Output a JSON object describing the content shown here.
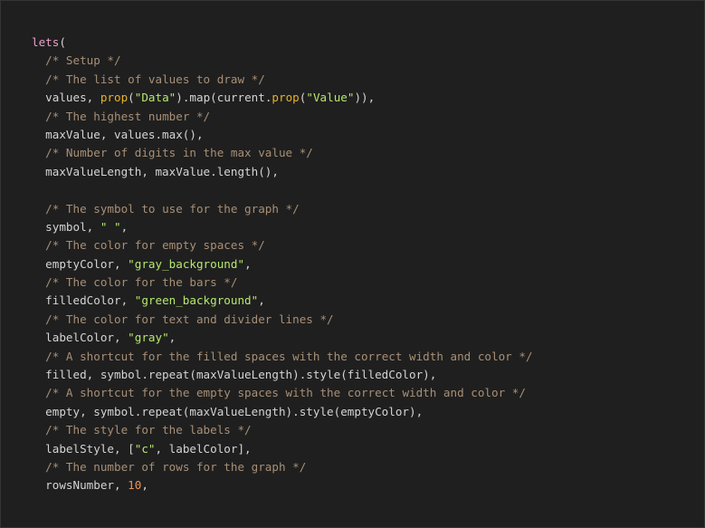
{
  "colors": {
    "background": "#1f1f1f",
    "text": "#d4d4d4",
    "comment": "#a88f76",
    "string": "#b5e86b",
    "function": "#e6b32a",
    "keyword": "#e8a0c8",
    "number": "#e8935b"
  },
  "code": {
    "lines": [
      [
        {
          "t": "lets",
          "k": "keyword"
        },
        {
          "t": "(",
          "k": "text"
        }
      ],
      [
        {
          "t": "  ",
          "k": "text"
        },
        {
          "t": "/* Setup */",
          "k": "comment"
        }
      ],
      [
        {
          "t": "  ",
          "k": "text"
        },
        {
          "t": "/* The list of values to draw */",
          "k": "comment"
        }
      ],
      [
        {
          "t": "  values, ",
          "k": "text"
        },
        {
          "t": "prop",
          "k": "func"
        },
        {
          "t": "(",
          "k": "text"
        },
        {
          "t": "\"Data\"",
          "k": "string"
        },
        {
          "t": ").map(current.",
          "k": "text"
        },
        {
          "t": "prop",
          "k": "func"
        },
        {
          "t": "(",
          "k": "text"
        },
        {
          "t": "\"Value\"",
          "k": "string"
        },
        {
          "t": ")),",
          "k": "text"
        }
      ],
      [
        {
          "t": "  ",
          "k": "text"
        },
        {
          "t": "/* The highest number */",
          "k": "comment"
        }
      ],
      [
        {
          "t": "  maxValue, values.max(),",
          "k": "text"
        }
      ],
      [
        {
          "t": "  ",
          "k": "text"
        },
        {
          "t": "/* Number of digits in the max value */",
          "k": "comment"
        }
      ],
      [
        {
          "t": "  maxValueLength, maxValue.length(),",
          "k": "text"
        }
      ],
      [],
      [
        {
          "t": "  ",
          "k": "text"
        },
        {
          "t": "/* The symbol to use for the graph */",
          "k": "comment"
        }
      ],
      [
        {
          "t": "  symbol, ",
          "k": "text"
        },
        {
          "t": "\" \"",
          "k": "string"
        },
        {
          "t": ",",
          "k": "text"
        }
      ],
      [
        {
          "t": "  ",
          "k": "text"
        },
        {
          "t": "/* The color for empty spaces */",
          "k": "comment"
        }
      ],
      [
        {
          "t": "  emptyColor, ",
          "k": "text"
        },
        {
          "t": "\"gray_background\"",
          "k": "string"
        },
        {
          "t": ",",
          "k": "text"
        }
      ],
      [
        {
          "t": "  ",
          "k": "text"
        },
        {
          "t": "/* The color for the bars */",
          "k": "comment"
        }
      ],
      [
        {
          "t": "  filledColor, ",
          "k": "text"
        },
        {
          "t": "\"green_background\"",
          "k": "string"
        },
        {
          "t": ",",
          "k": "text"
        }
      ],
      [
        {
          "t": "  ",
          "k": "text"
        },
        {
          "t": "/* The color for text and divider lines */",
          "k": "comment"
        }
      ],
      [
        {
          "t": "  labelColor, ",
          "k": "text"
        },
        {
          "t": "\"gray\"",
          "k": "string"
        },
        {
          "t": ",",
          "k": "text"
        }
      ],
      [
        {
          "t": "  ",
          "k": "text"
        },
        {
          "t": "/* A shortcut for the filled spaces with the correct width and color */",
          "k": "comment"
        }
      ],
      [
        {
          "t": "  filled, symbol.repeat(maxValueLength).style(filledColor),",
          "k": "text"
        }
      ],
      [
        {
          "t": "  ",
          "k": "text"
        },
        {
          "t": "/* A shortcut for the empty spaces with the correct width and color */",
          "k": "comment"
        }
      ],
      [
        {
          "t": "  empty, symbol.repeat(maxValueLength).style(emptyColor),",
          "k": "text"
        }
      ],
      [
        {
          "t": "  ",
          "k": "text"
        },
        {
          "t": "/* The style for the labels */",
          "k": "comment"
        }
      ],
      [
        {
          "t": "  labelStyle, [",
          "k": "text"
        },
        {
          "t": "\"c\"",
          "k": "string"
        },
        {
          "t": ", labelColor],",
          "k": "text"
        }
      ],
      [
        {
          "t": "  ",
          "k": "text"
        },
        {
          "t": "/* The number of rows for the graph */",
          "k": "comment"
        }
      ],
      [
        {
          "t": "  rowsNumber, ",
          "k": "text"
        },
        {
          "t": "10",
          "k": "number"
        },
        {
          "t": ",",
          "k": "text"
        }
      ]
    ]
  }
}
